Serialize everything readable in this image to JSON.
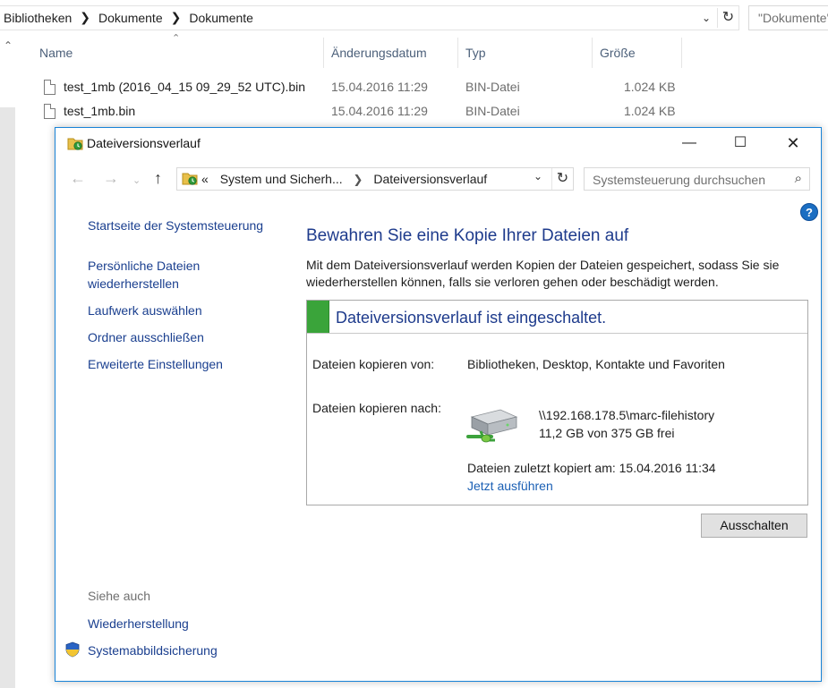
{
  "explorer": {
    "breadcrumb": [
      "Bibliotheken",
      "Dokumente",
      "Dokumente"
    ],
    "search_placeholder": "\"Dokumente\" durchsuchen",
    "columns": {
      "name": "Name",
      "date": "Änderungsdatum",
      "type": "Typ",
      "size": "Größe"
    },
    "files": [
      {
        "name": "test_1mb (2016_04_15 09_29_52 UTC).bin",
        "date": "15.04.2016 11:29",
        "type": "BIN-Datei",
        "size": "1.024 KB"
      },
      {
        "name": "test_1mb.bin",
        "date": "15.04.2016 11:29",
        "type": "BIN-Datei",
        "size": "1.024 KB"
      }
    ]
  },
  "dialog": {
    "title": "Dateiversionsverlauf",
    "path": {
      "prefix": "«",
      "segments": [
        "System und Sicherh...",
        "Dateiversionsverlauf"
      ]
    },
    "search_placeholder": "Systemsteuerung durchsuchen",
    "help_label": "?",
    "sidebar": {
      "links": [
        "Startseite der Systemsteuerung",
        "Persönliche Dateien wiederherstellen",
        "Laufwerk auswählen",
        "Ordner ausschließen",
        "Erweiterte Einstellungen"
      ],
      "see_also_label": "Siehe auch",
      "see_also": [
        "Wiederherstellung",
        "Systemabbildsicherung"
      ]
    },
    "main": {
      "heading": "Bewahren Sie eine Kopie Ihrer Dateien auf",
      "description": "Mit dem Dateiversionsverlauf werden Kopien der Dateien gespeichert, sodass Sie sie wiederherstellen können, falls sie verloren gehen oder beschädigt werden.",
      "status_title": "Dateiversionsverlauf ist eingeschaltet.",
      "copy_from_label": "Dateien kopieren von:",
      "copy_from_value": "Bibliotheken, Desktop, Kontakte und Favoriten",
      "copy_to_label": "Dateien kopieren nach:",
      "drive_path": "\\\\192.168.178.5\\marc-filehistory",
      "drive_space": "11,2 GB von 375 GB frei",
      "last_copy": "Dateien zuletzt kopiert am: 15.04.2016 11:34",
      "run_now": "Jetzt ausführen",
      "turn_off_button": "Ausschalten"
    },
    "colors": {
      "accent_border": "#1883d7",
      "heading_blue": "#1e3b8c",
      "link_blue": "#1a3f8f",
      "status_green": "#3aa43a"
    },
    "icons": [
      "file-history-icon",
      "back-arrow-icon",
      "forward-arrow-icon",
      "up-arrow-icon",
      "refresh-icon",
      "search-icon",
      "help-icon",
      "network-drive-icon",
      "uac-shield-icon"
    ]
  }
}
